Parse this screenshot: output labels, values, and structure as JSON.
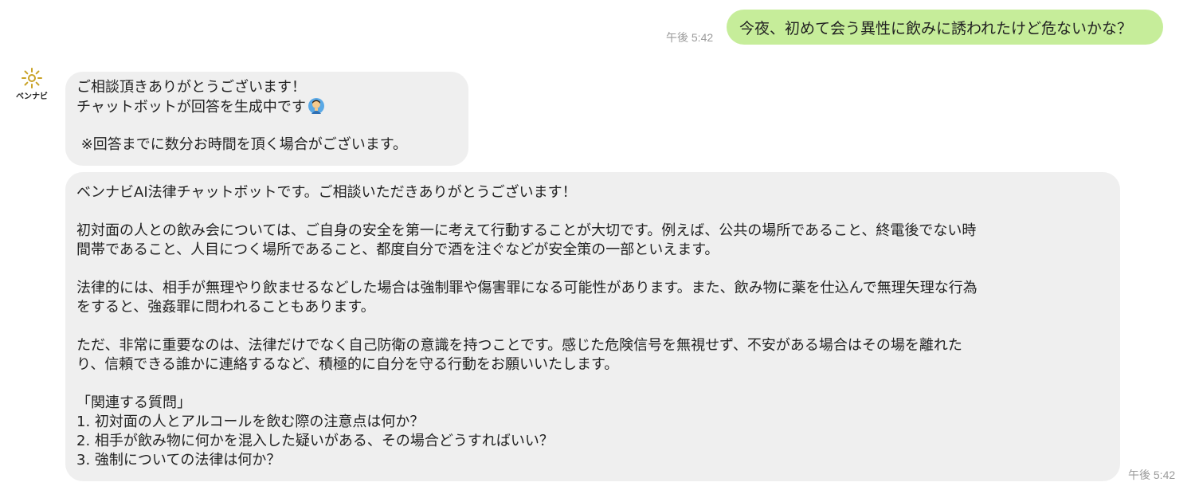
{
  "user_message": {
    "text": "今夜、初めて会う異性に飲みに誘われたけど危ないかな？",
    "time": "午後 5:42",
    "bubble_color": "#c6ed9a"
  },
  "bot": {
    "name": "ベンナビ",
    "logo_color": "#c9a227",
    "bubble_color": "#efefef",
    "message_1": {
      "lines": [
        "ご相談頂きありがとうございます！",
        "チャットボットが回答を生成中です",
        "",
        " ※回答までに数分お時間を頂く場合がございます。"
      ],
      "emoji_icon": "person-bowing-icon"
    },
    "message_2": {
      "lines": [
        "ベンナビAI法律チャットボットです。ご相談いただきありがとうございます！",
        "",
        "初対面の人との飲み会については、ご自身の安全を第一に考えて行動することが大切です。例えば、公共の場所であること、終電後でない時",
        "間帯であること、人目につく場所であること、都度自分で酒を注ぐなどが安全策の一部といえます。",
        "",
        "法律的には、相手が無理やり飲ませるなどした場合は強制罪や傷害罪になる可能性があります。また、飲み物に薬を仕込んで無理矢理な行為",
        "をすると、強姦罪に問われることもあります。",
        "",
        "ただ、非常に重要なのは、法律だけでなく自己防衛の意識を持つことです。感じた危険信号を無視せず、不安がある場合はその場を離れた",
        "り、信頼できる誰かに連絡するなど、積極的に自分を守る行動をお願いいたします。",
        "",
        "「関連する質問」",
        "1. 初対面の人とアルコールを飲む際の注意点は何か？",
        "2. 相手が飲み物に何かを混入した疑いがある、その場合どうすればいい？",
        "3. 強制についての法律は何か？"
      ],
      "time": "午後 5:42"
    }
  }
}
